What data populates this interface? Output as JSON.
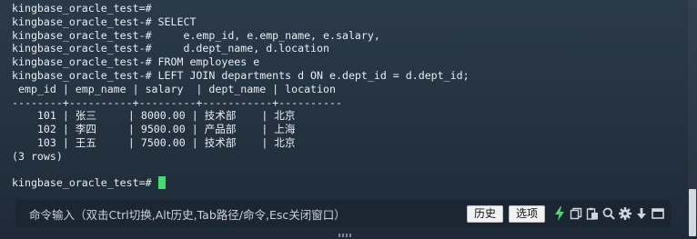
{
  "terminal": {
    "lines": [
      "kingbase_oracle_test=#",
      "kingbase_oracle_test-# SELECT",
      "kingbase_oracle_test-#     e.emp_id, e.emp_name, e.salary,",
      "kingbase_oracle_test-#     d.dept_name, d.location",
      "kingbase_oracle_test-# FROM employees e",
      "kingbase_oracle_test-# LEFT JOIN departments d ON e.dept_id = d.dept_id;",
      " emp_id | emp_name | salary  | dept_name | location",
      "--------+----------+---------+-----------+----------",
      "    101 | 张三     | 8000.00 | 技术部    | 北京",
      "    102 | 李四     | 9500.00 | 产品部    | 上海",
      "    103 | 王五     | 7500.00 | 技术部    | 北京",
      "(3 rows)",
      ""
    ],
    "prompt": "kingbase_oracle_test=# "
  },
  "cmdbar": {
    "hint": "命令输入（双击Ctrl切换,Alt历史,Tab路径/命令,Esc关闭窗口）",
    "history_label": "历史",
    "options_label": "选项"
  },
  "icons": [
    "lightning-icon",
    "copy-icon",
    "paste-icon",
    "search-icon",
    "gear-icon",
    "arrow-down-icon",
    "window-icon"
  ],
  "colors": {
    "background": "#243240",
    "text": "#e8edf1",
    "cursor": "#3fe06a",
    "lightning": "#3fe06a"
  }
}
